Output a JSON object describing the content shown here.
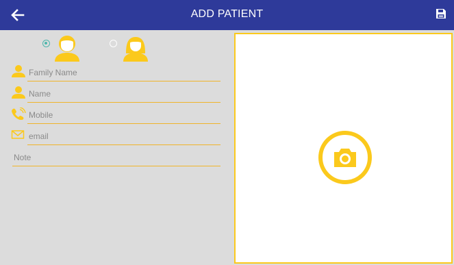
{
  "header": {
    "title": "ADD PATIENT",
    "back_icon": "arrow-left-icon",
    "save_icon": "save-icon"
  },
  "gender": {
    "options": [
      {
        "name": "male",
        "selected": true,
        "icon": "male-avatar-icon"
      },
      {
        "name": "female",
        "selected": false,
        "icon": "female-avatar-icon"
      }
    ]
  },
  "form": {
    "family_name_placeholder": "Family Name",
    "name_placeholder": "Name",
    "mobile_placeholder": "Mobile",
    "email_placeholder": "email",
    "note_placeholder": "Note"
  },
  "photo": {
    "icon": "camera-icon"
  },
  "colors": {
    "header": "#2e3a9a",
    "accent": "#fbc91c",
    "panel": "#dcdcdc",
    "radio_selected": "#4db6ac"
  }
}
